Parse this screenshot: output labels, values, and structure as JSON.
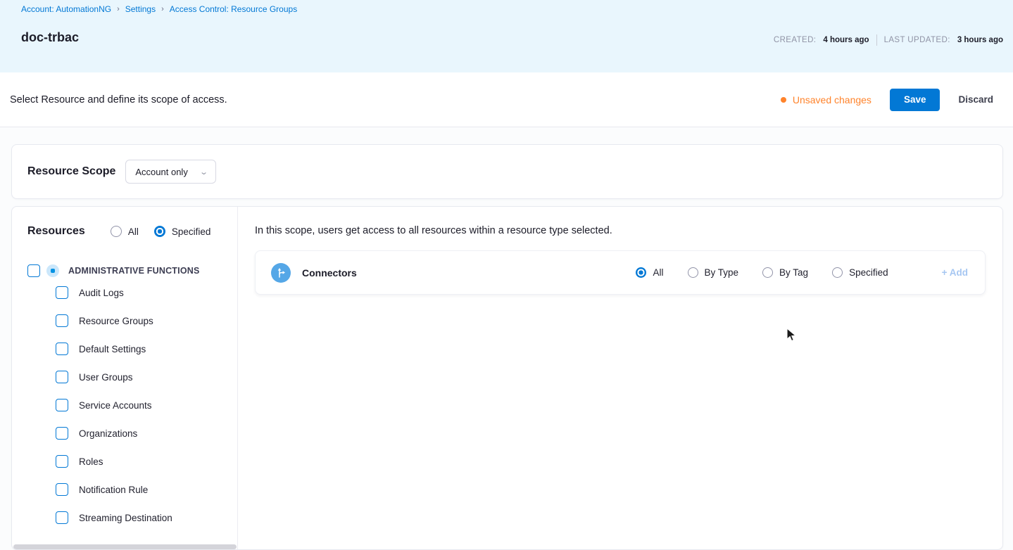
{
  "breadcrumb": {
    "separator": "›",
    "items": [
      "Account: AutomationNG",
      "Settings",
      "Access Control: Resource Groups"
    ]
  },
  "header": {
    "title": "doc-trbac",
    "created_label": "CREATED:",
    "created_value": "4 hours ago",
    "updated_label": "LAST UPDATED:",
    "updated_value": "3 hours ago"
  },
  "toolbar": {
    "description": "Select Resource and define its scope of access.",
    "unsaved_label": "Unsaved changes",
    "save_label": "Save",
    "discard_label": "Discard"
  },
  "resource_scope": {
    "title": "Resource Scope",
    "selected_value": "Account only"
  },
  "resources": {
    "title": "Resources",
    "options": [
      {
        "label": "All",
        "selected": false
      },
      {
        "label": "Specified",
        "selected": true
      }
    ],
    "group": {
      "label": "ADMINISTRATIVE FUNCTIONS",
      "checked": false
    },
    "items": [
      "Audit Logs",
      "Resource Groups",
      "Default Settings",
      "User Groups",
      "Service Accounts",
      "Organizations",
      "Roles",
      "Notification Rule",
      "Streaming Destination"
    ]
  },
  "scope_panel": {
    "description": "In this scope, users get access to all resources within a resource type selected.",
    "row": {
      "name": "Connectors",
      "options": [
        {
          "label": "All",
          "selected": true
        },
        {
          "label": "By Type",
          "selected": false
        },
        {
          "label": "By Tag",
          "selected": false
        },
        {
          "label": "Specified",
          "selected": false
        }
      ],
      "add_label": "+ Add"
    }
  },
  "colors": {
    "accent_blue": "#0278d5",
    "topbar_bg": "#e9f6fd",
    "unsaved_orange": "#ff832b",
    "add_link_disabled": "#a6c7f2",
    "connector_icon_bg": "#55a7e7"
  }
}
